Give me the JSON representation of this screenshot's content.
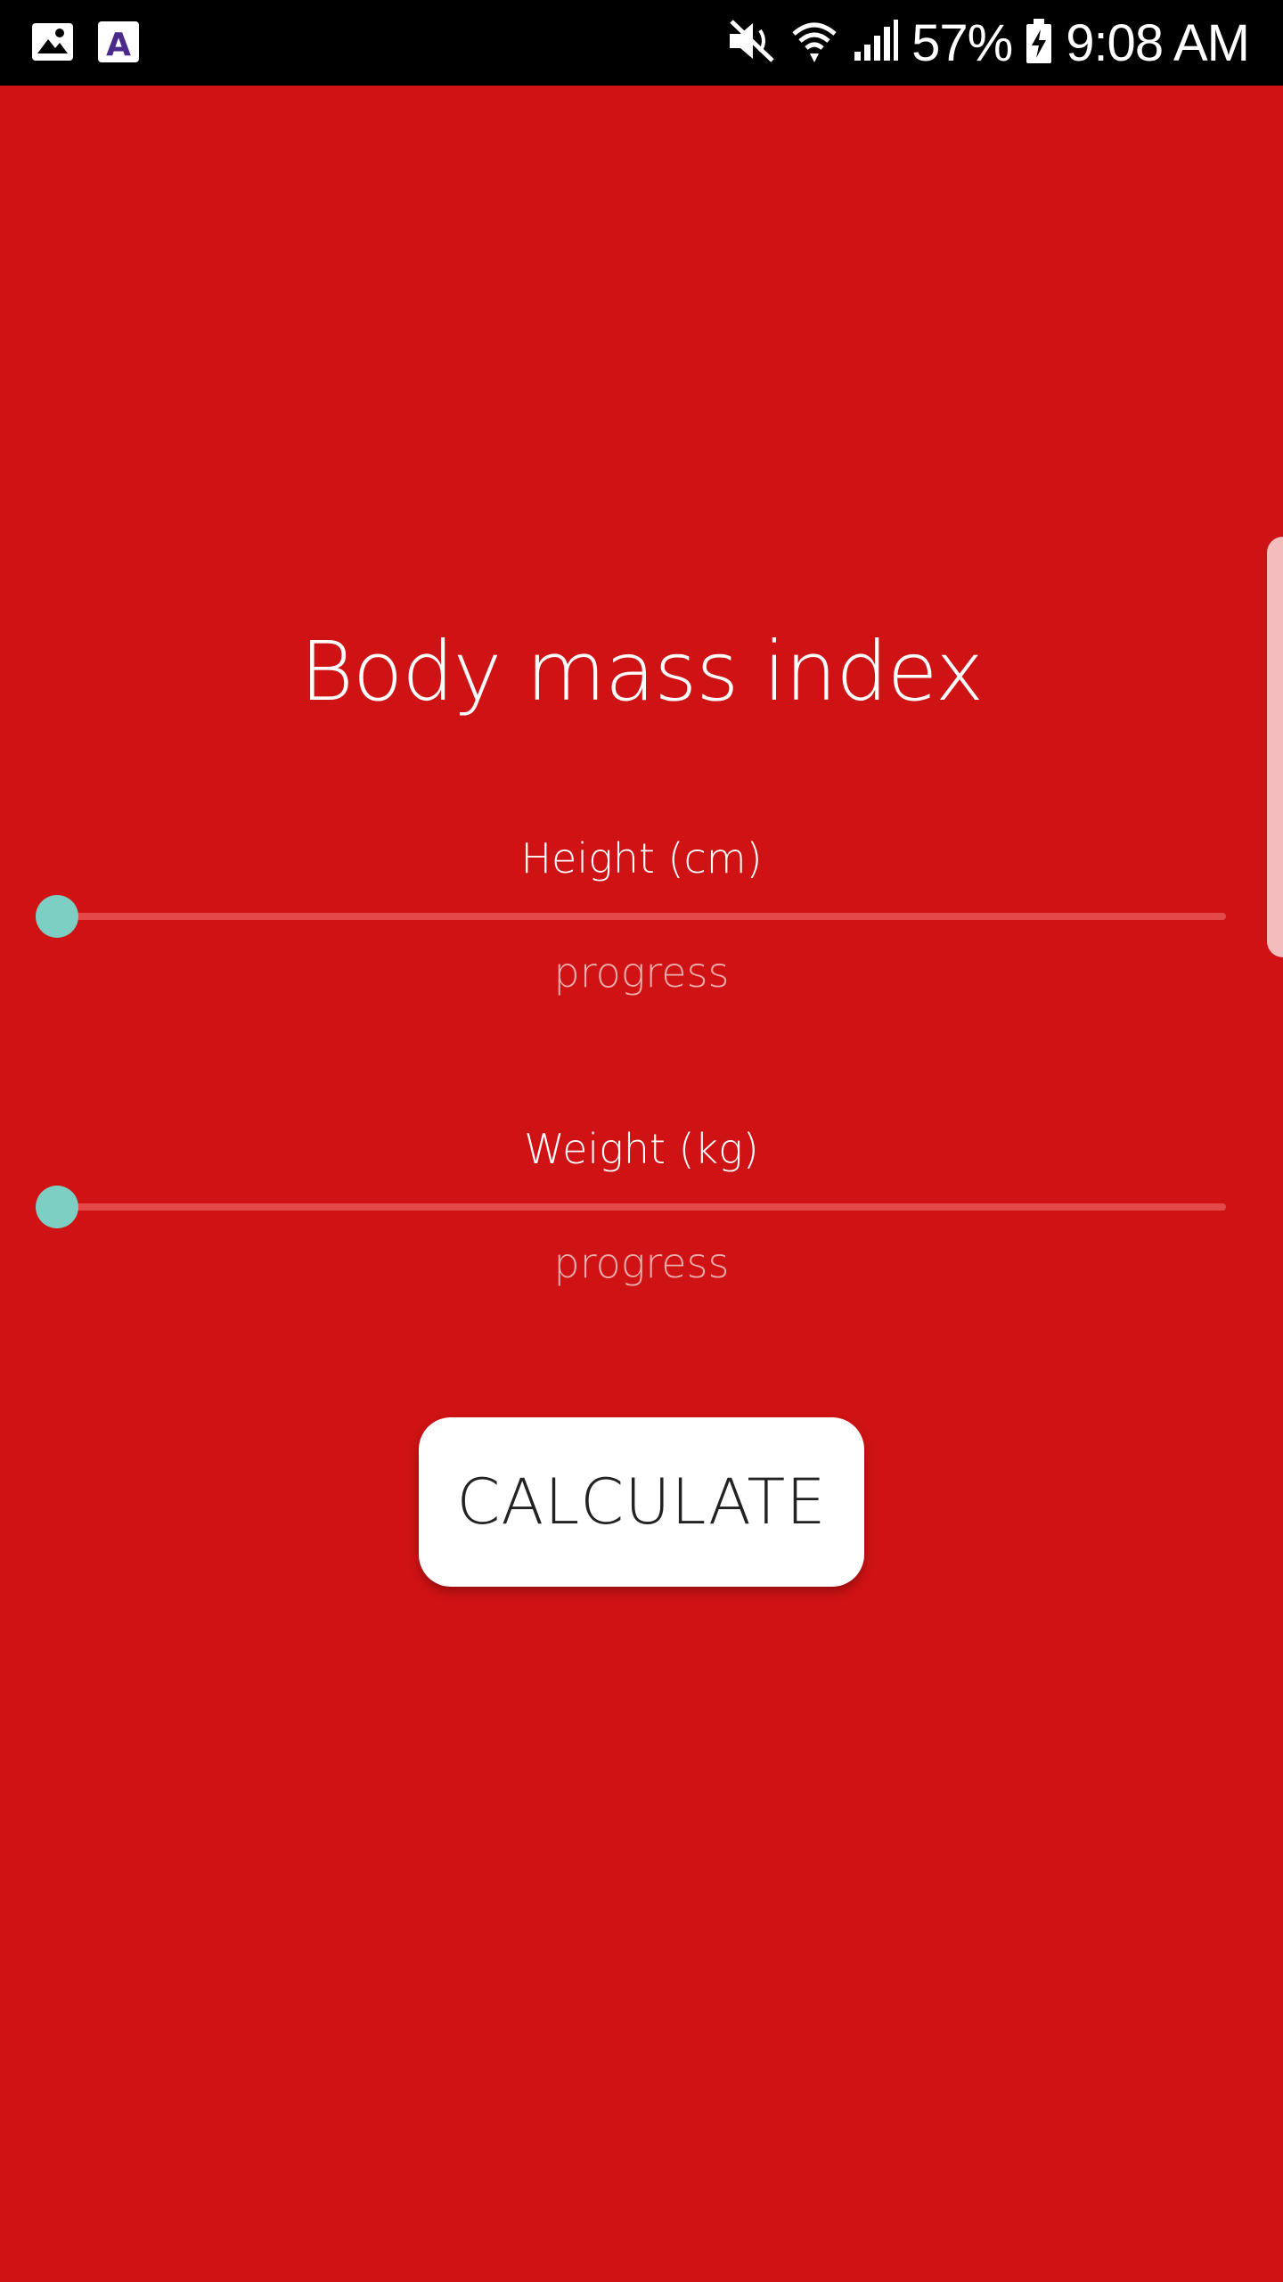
{
  "status_bar": {
    "left_icons": [
      "gallery-icon",
      "app-a-icon"
    ],
    "right_icons": [
      "mute-icon",
      "wifi-icon",
      "signal-icon",
      "battery-charging-icon"
    ],
    "battery": "57%",
    "time": "9:08 AM"
  },
  "app": {
    "title": "Body mass index",
    "height": {
      "label": "Height (cm)",
      "value_text": "progress",
      "slider_level": 0
    },
    "weight": {
      "label": "Weight (kg)",
      "value_text": "progress",
      "slider_level": 0
    },
    "calculate_label": "CALCULATE"
  },
  "colors": {
    "background": "#cf1214",
    "thumb": "#7ecfc3",
    "track": "#e24a4a",
    "button": "#ffffff"
  }
}
